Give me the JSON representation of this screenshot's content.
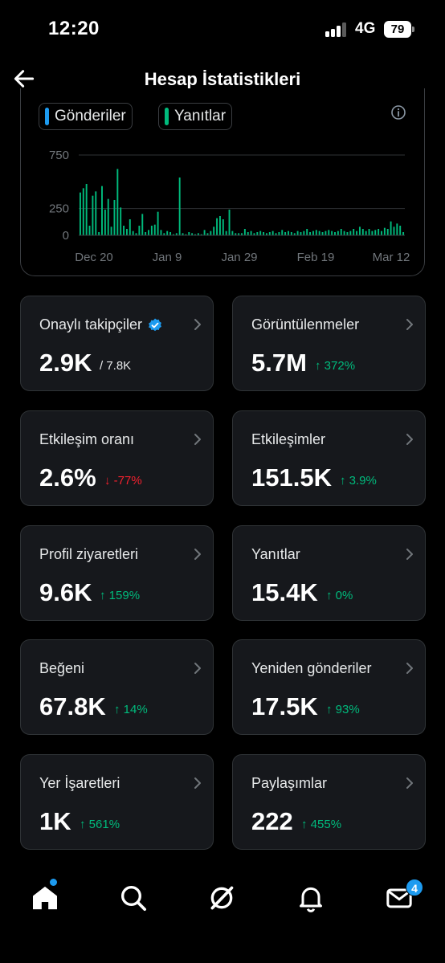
{
  "status_bar": {
    "time": "12:20",
    "network": "4G",
    "battery": "79"
  },
  "header": {
    "title": "Hesap İstatistikleri"
  },
  "chart": {
    "legend": [
      {
        "label": "Gönderiler",
        "color": "#1d9bf0"
      },
      {
        "label": "Yanıtlar",
        "color": "#00ba7c"
      }
    ]
  },
  "chart_data": {
    "type": "bar",
    "title": "",
    "xlabel": "",
    "ylabel": "",
    "ylim": [
      0,
      750
    ],
    "y_ticks": [
      "750",
      "250",
      "0"
    ],
    "x_ticks": [
      "Dec 20",
      "Jan 9",
      "Jan 29",
      "Feb 19",
      "Mar 12"
    ],
    "grid": true,
    "legend_placement": "top-left",
    "series": [
      {
        "name": "Yanıtlar",
        "color": "#00ba7c",
        "values": [
          400,
          440,
          480,
          90,
          370,
          410,
          30,
          460,
          240,
          340,
          80,
          330,
          620,
          260,
          90,
          60,
          150,
          40,
          20,
          90,
          200,
          30,
          50,
          90,
          100,
          220,
          50,
          20,
          40,
          30,
          10,
          20,
          540,
          20,
          10,
          30,
          20,
          10,
          20,
          10,
          50,
          20,
          40,
          80,
          160,
          180,
          150,
          40,
          240,
          40,
          20,
          20,
          20,
          60,
          30,
          40,
          20,
          30,
          40,
          30,
          20,
          30,
          40,
          20,
          30,
          50,
          30,
          40,
          30,
          20,
          40,
          30,
          40,
          60,
          30,
          40,
          50,
          40,
          30,
          40,
          50,
          40,
          30,
          40,
          60,
          40,
          30,
          40,
          60,
          40,
          80,
          60,
          40,
          60,
          40,
          50,
          60,
          40,
          70,
          60,
          130,
          80,
          110,
          90,
          30
        ]
      }
    ]
  },
  "cards": [
    {
      "label": "Onaylı takipçiler",
      "value": "2.9K",
      "sub": "/ 7.8K",
      "trend": "none",
      "verified": true
    },
    {
      "label": "Görüntülenmeler",
      "value": "5.7M",
      "sub": "↑ 372%",
      "trend": "up"
    },
    {
      "label": "Etkileşim oranı",
      "value": "2.6%",
      "sub": "↓ -77%",
      "trend": "down"
    },
    {
      "label": "Etkileşimler",
      "value": "151.5K",
      "sub": "↑ 3.9%",
      "trend": "up"
    },
    {
      "label": "Profil ziyaretleri",
      "value": "9.6K",
      "sub": "↑ 159%",
      "trend": "up"
    },
    {
      "label": "Yanıtlar",
      "value": "15.4K",
      "sub": "↑ 0%",
      "trend": "up"
    },
    {
      "label": "Beğeni",
      "value": "67.8K",
      "sub": "↑ 14%",
      "trend": "up"
    },
    {
      "label": "Yeniden gönderiler",
      "value": "17.5K",
      "sub": "↑ 93%",
      "trend": "up"
    },
    {
      "label": "Yer İşaretleri",
      "value": "1K",
      "sub": "↑ 561%",
      "trend": "up"
    },
    {
      "label": "Paylaşımlar",
      "value": "222",
      "sub": "↑ 455%",
      "trend": "up"
    }
  ],
  "tabbar": {
    "icons": [
      "home-icon",
      "search-icon",
      "grok-icon",
      "notifications-icon",
      "messages-icon"
    ],
    "messages_badge": "4"
  },
  "colors": {
    "accent": "#1d9bf0",
    "positive": "#00ba7c",
    "negative": "#f4212e",
    "card_bg": "#16181c"
  }
}
